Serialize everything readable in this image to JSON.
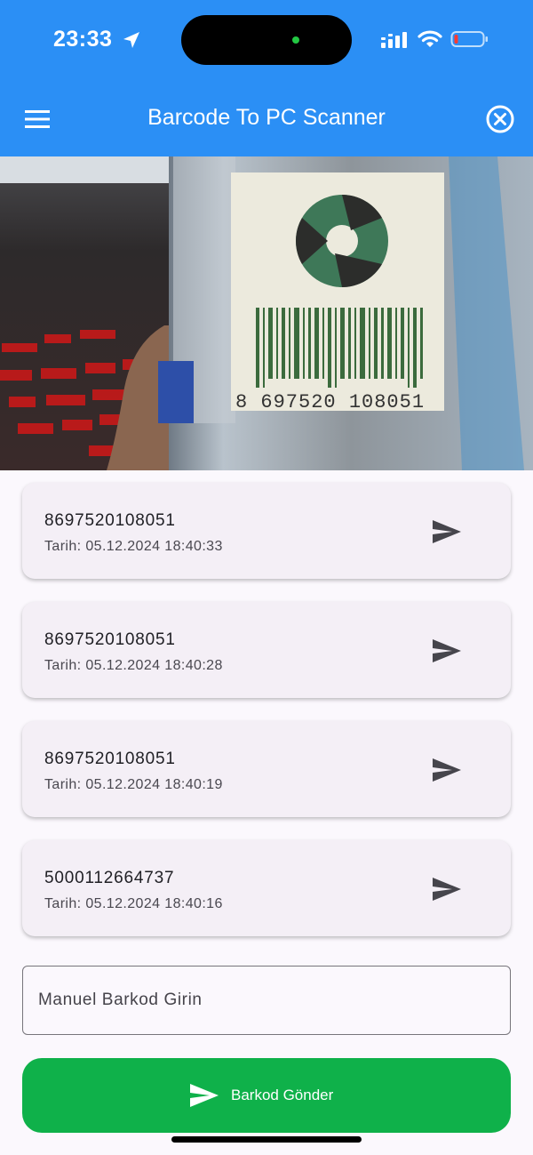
{
  "status_bar": {
    "time": "23:33",
    "icons": [
      "location-arrow-icon",
      "cellular-signal-icon",
      "wifi-icon",
      "battery-icon"
    ]
  },
  "app_bar": {
    "title": "Barcode To PC Scanner",
    "left_icon": "menu-icon",
    "right_icon": "close-circle-icon"
  },
  "camera": {
    "printed_barcode_text": "8 697520 108051"
  },
  "scans": [
    {
      "code": "8697520108051",
      "date": "Tarih: 05.12.2024 18:40:33"
    },
    {
      "code": "8697520108051",
      "date": "Tarih: 05.12.2024 18:40:28"
    },
    {
      "code": "8697520108051",
      "date": "Tarih: 05.12.2024 18:40:19"
    },
    {
      "code": "5000112664737",
      "date": "Tarih: 05.12.2024 18:40:16"
    }
  ],
  "manual": {
    "placeholder": "Manuel Barkod Girin",
    "value": ""
  },
  "send_button": {
    "label": "Barkod Gönder",
    "icon": "send-icon"
  },
  "colors": {
    "app_bar": "#2b8ff5",
    "send_button": "#0fb14a",
    "card": "#f4eff6",
    "background": "#fbf8fd"
  }
}
